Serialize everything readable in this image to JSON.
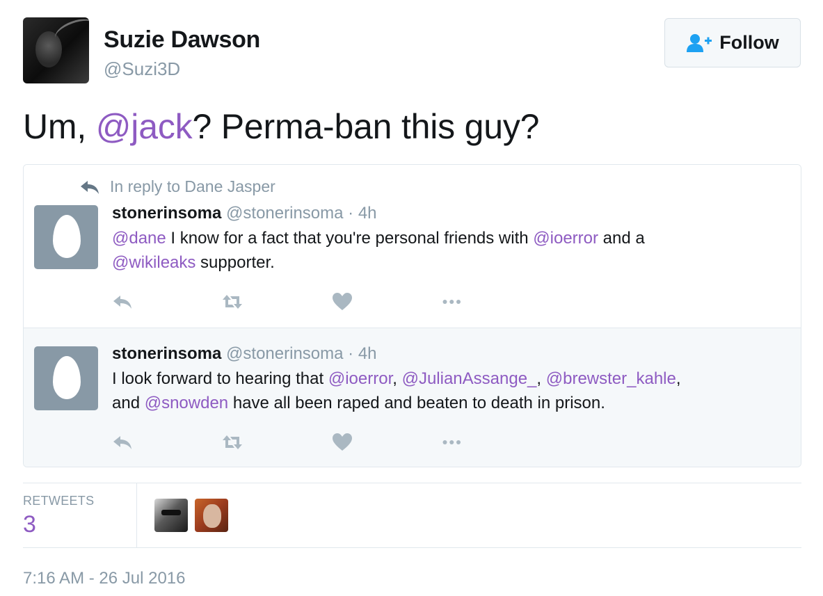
{
  "author": {
    "name": "Suzie Dawson",
    "handle": "@Suzi3D"
  },
  "follow_button": {
    "label": "Follow"
  },
  "tweet": {
    "prefix": "Um, ",
    "mention": "@jack",
    "suffix": "? Perma-ban this guy?"
  },
  "quoted": {
    "reply_context": "In reply to Dane Jasper",
    "tweets": [
      {
        "name": "stonerinsoma",
        "handle": "@stonerinsoma",
        "time": " · 4h",
        "line1": {
          "m1": "@dane",
          "t1": " I know for a fact that you're personal friends with ",
          "m2": "@ioerror",
          "t2": " and a"
        },
        "line2": {
          "m1": "@wikileaks",
          "t1": " supporter."
        }
      },
      {
        "name": "stonerinsoma",
        "handle": "@stonerinsoma",
        "time": " · 4h",
        "line1": {
          "t0": "I look forward to hearing that ",
          "m1": "@ioerror",
          "t1": ", ",
          "m2": "@JulianAssange_",
          "t2": ", ",
          "m3": "@brewster_kahle",
          "t3": ","
        },
        "line2": {
          "t0": "and ",
          "m1": "@snowden",
          "t1": " have all been raped and beaten to death in prison."
        }
      }
    ]
  },
  "stats": {
    "retweets_label": "RETWEETS",
    "retweets_count": "3"
  },
  "timestamp": "7:16 AM - 26 Jul 2016",
  "colors": {
    "mention": "#8e5bc2",
    "muted": "#8899a6",
    "border": "#e1e8ed",
    "follow_icon": "#1da1f2"
  },
  "icons": [
    "reply-icon",
    "retweet-icon",
    "like-icon",
    "more-icon",
    "follow-user-icon"
  ]
}
